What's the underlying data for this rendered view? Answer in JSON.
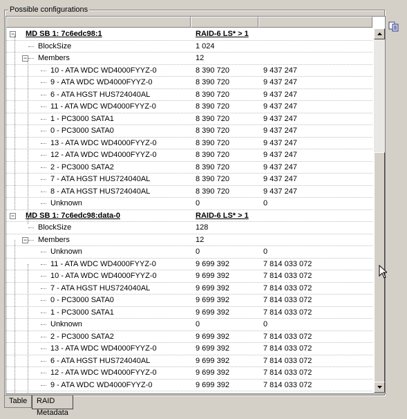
{
  "groupbox": {
    "title": "Possible configurations"
  },
  "icons": {
    "copy": "copy-icon",
    "cursor": "arrow-cursor-icon"
  },
  "tree": {
    "rows": [
      {
        "level": 0,
        "name": "MD SB 1: 7c6edc98:1",
        "v1": "RAID-6 LS* > 1",
        "v2": "",
        "bold": true,
        "expander": "minus"
      },
      {
        "level": 1,
        "name": "BlockSize",
        "v1": "1 024",
        "v2": ""
      },
      {
        "level": 1,
        "name": "Members",
        "v1": "12",
        "v2": "",
        "expander": "minus"
      },
      {
        "level": 2,
        "name": "10 - ATA WDC WD4000FYYZ-0",
        "v1": "8 390 720",
        "v2": "9 437 247"
      },
      {
        "level": 2,
        "name": "9 - ATA WDC WD4000FYYZ-0",
        "v1": "8 390 720",
        "v2": "9 437 247"
      },
      {
        "level": 2,
        "name": "6 - ATA HGST HUS724040AL",
        "v1": "8 390 720",
        "v2": "9 437 247"
      },
      {
        "level": 2,
        "name": "11 - ATA WDC WD4000FYYZ-0",
        "v1": "8 390 720",
        "v2": "9 437 247"
      },
      {
        "level": 2,
        "name": "1 - PC3000 SATA1",
        "v1": "8 390 720",
        "v2": "9 437 247"
      },
      {
        "level": 2,
        "name": "0 - PC3000 SATA0",
        "v1": "8 390 720",
        "v2": "9 437 247"
      },
      {
        "level": 2,
        "name": "13 - ATA WDC WD4000FYYZ-0",
        "v1": "8 390 720",
        "v2": "9 437 247"
      },
      {
        "level": 2,
        "name": "12 - ATA WDC WD4000FYYZ-0",
        "v1": "8 390 720",
        "v2": "9 437 247"
      },
      {
        "level": 2,
        "name": "2 - PC3000 SATA2",
        "v1": "8 390 720",
        "v2": "9 437 247"
      },
      {
        "level": 2,
        "name": "7 - ATA HGST HUS724040AL",
        "v1": "8 390 720",
        "v2": "9 437 247"
      },
      {
        "level": 2,
        "name": "8 - ATA HGST HUS724040AL",
        "v1": "8 390 720",
        "v2": "9 437 247"
      },
      {
        "level": 2,
        "name": "Unknown",
        "v1": "0",
        "v2": "0"
      },
      {
        "level": 0,
        "name": "MD SB 1: 7c6edc98:data-0",
        "v1": "RAID-6 LS* > 1",
        "v2": "",
        "bold": true,
        "expander": "minus"
      },
      {
        "level": 1,
        "name": "BlockSize",
        "v1": "128",
        "v2": ""
      },
      {
        "level": 1,
        "name": "Members",
        "v1": "12",
        "v2": "",
        "expander": "minus"
      },
      {
        "level": 2,
        "name": "Unknown",
        "v1": "0",
        "v2": "0"
      },
      {
        "level": 2,
        "name": "11 - ATA WDC WD4000FYYZ-0",
        "v1": "9 699 392",
        "v2": "7 814 033 072"
      },
      {
        "level": 2,
        "name": "10 - ATA WDC WD4000FYYZ-0",
        "v1": "9 699 392",
        "v2": "7 814 033 072"
      },
      {
        "level": 2,
        "name": "7 - ATA HGST HUS724040AL",
        "v1": "9 699 392",
        "v2": "7 814 033 072"
      },
      {
        "level": 2,
        "name": "0 - PC3000 SATA0",
        "v1": "9 699 392",
        "v2": "7 814 033 072"
      },
      {
        "level": 2,
        "name": "1 - PC3000 SATA1",
        "v1": "9 699 392",
        "v2": "7 814 033 072"
      },
      {
        "level": 2,
        "name": "Unknown",
        "v1": "0",
        "v2": "0"
      },
      {
        "level": 2,
        "name": "2 - PC3000 SATA2",
        "v1": "9 699 392",
        "v2": "7 814 033 072"
      },
      {
        "level": 2,
        "name": "13 - ATA WDC WD4000FYYZ-0",
        "v1": "9 699 392",
        "v2": "7 814 033 072"
      },
      {
        "level": 2,
        "name": "6 - ATA HGST HUS724040AL",
        "v1": "9 699 392",
        "v2": "7 814 033 072"
      },
      {
        "level": 2,
        "name": "12 - ATA WDC WD4000FYYZ-0",
        "v1": "9 699 392",
        "v2": "7 814 033 072"
      },
      {
        "level": 2,
        "name": "9 - ATA WDC WD4000FYYZ-0",
        "v1": "9 699 392",
        "v2": "7 814 033 072"
      }
    ]
  },
  "tabs": [
    {
      "label": "Table",
      "active": false
    },
    {
      "label": "RAID Metadata",
      "active": true
    }
  ]
}
